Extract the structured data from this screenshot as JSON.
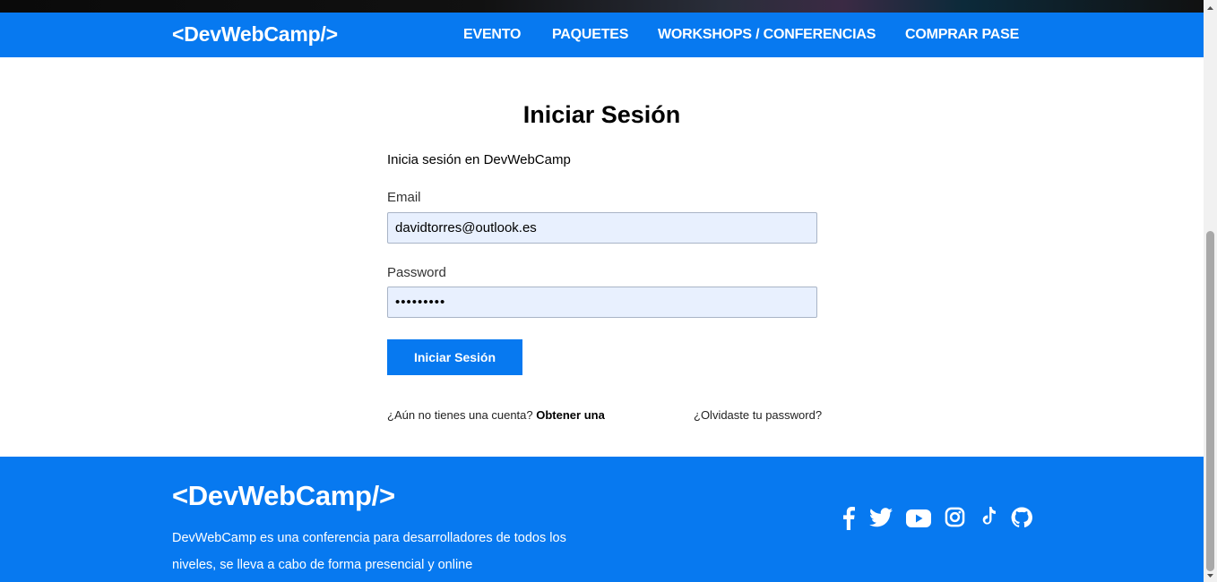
{
  "brand": "<DevWebCamp/>",
  "nav": [
    {
      "label": "EVENTO"
    },
    {
      "label": "PAQUETES"
    },
    {
      "label": "WORKSHOPS / CONFERENCIAS"
    },
    {
      "label": "COMPRAR PASE"
    }
  ],
  "login": {
    "title": "Iniciar Sesión",
    "subtitle": "Inicia sesión en DevWebCamp",
    "email_label": "Email",
    "email_value": "davidtorres@outlook.es",
    "password_label": "Password",
    "password_value": "•••••••••",
    "submit_label": "Iniciar Sesión",
    "no_account_text": "¿Aún no tienes una cuenta?",
    "no_account_link": "Obtener una",
    "forgot_link": "¿Olvidaste tu password?"
  },
  "footer": {
    "brand": "<DevWebCamp/>",
    "description": "DevWebCamp es una conferencia para desarrolladores de todos los niveles, se lleva a cabo de forma presencial y online",
    "social_icons": [
      "facebook-icon",
      "twitter-icon",
      "youtube-icon",
      "instagram-icon",
      "tiktok-icon",
      "github-icon"
    ]
  },
  "colors": {
    "brand_blue": "#0779f0",
    "input_bg": "#e8f0fe"
  }
}
